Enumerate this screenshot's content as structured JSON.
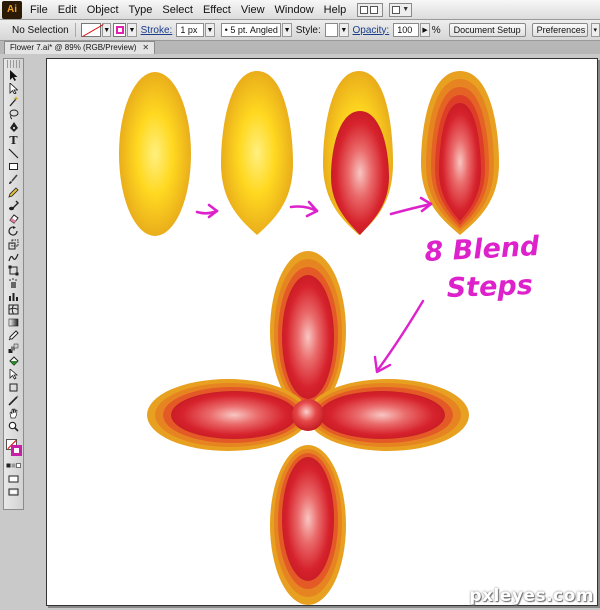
{
  "menubar": {
    "logo": "Ai",
    "items": [
      "File",
      "Edit",
      "Object",
      "Type",
      "Select",
      "Effect",
      "View",
      "Window",
      "Help"
    ]
  },
  "controlbar": {
    "selection": "No Selection",
    "stroke_label": "Stroke:",
    "stroke_weight": "1 px",
    "brush": "5 pt. Angled",
    "style_label": "Style:",
    "opacity_label": "Opacity:",
    "opacity_value": "100",
    "percent": "%",
    "document_setup": "Document Setup",
    "preferences": "Preferences"
  },
  "tab": {
    "title": "Flower 7.ai* @ 89% (RGB/Preview)",
    "close": "✕"
  },
  "annotation": {
    "line1": "8 Blend",
    "line2": "Steps"
  },
  "watermark": "pxleyes.com",
  "colors": {
    "yellow_center": "#ffe63a",
    "yellow_edge": "#e5a51a",
    "red_center": "#f6b6b4",
    "red_mid": "#d9272f",
    "orange_edge": "#e8a020",
    "magenta": "#dd22cc"
  }
}
